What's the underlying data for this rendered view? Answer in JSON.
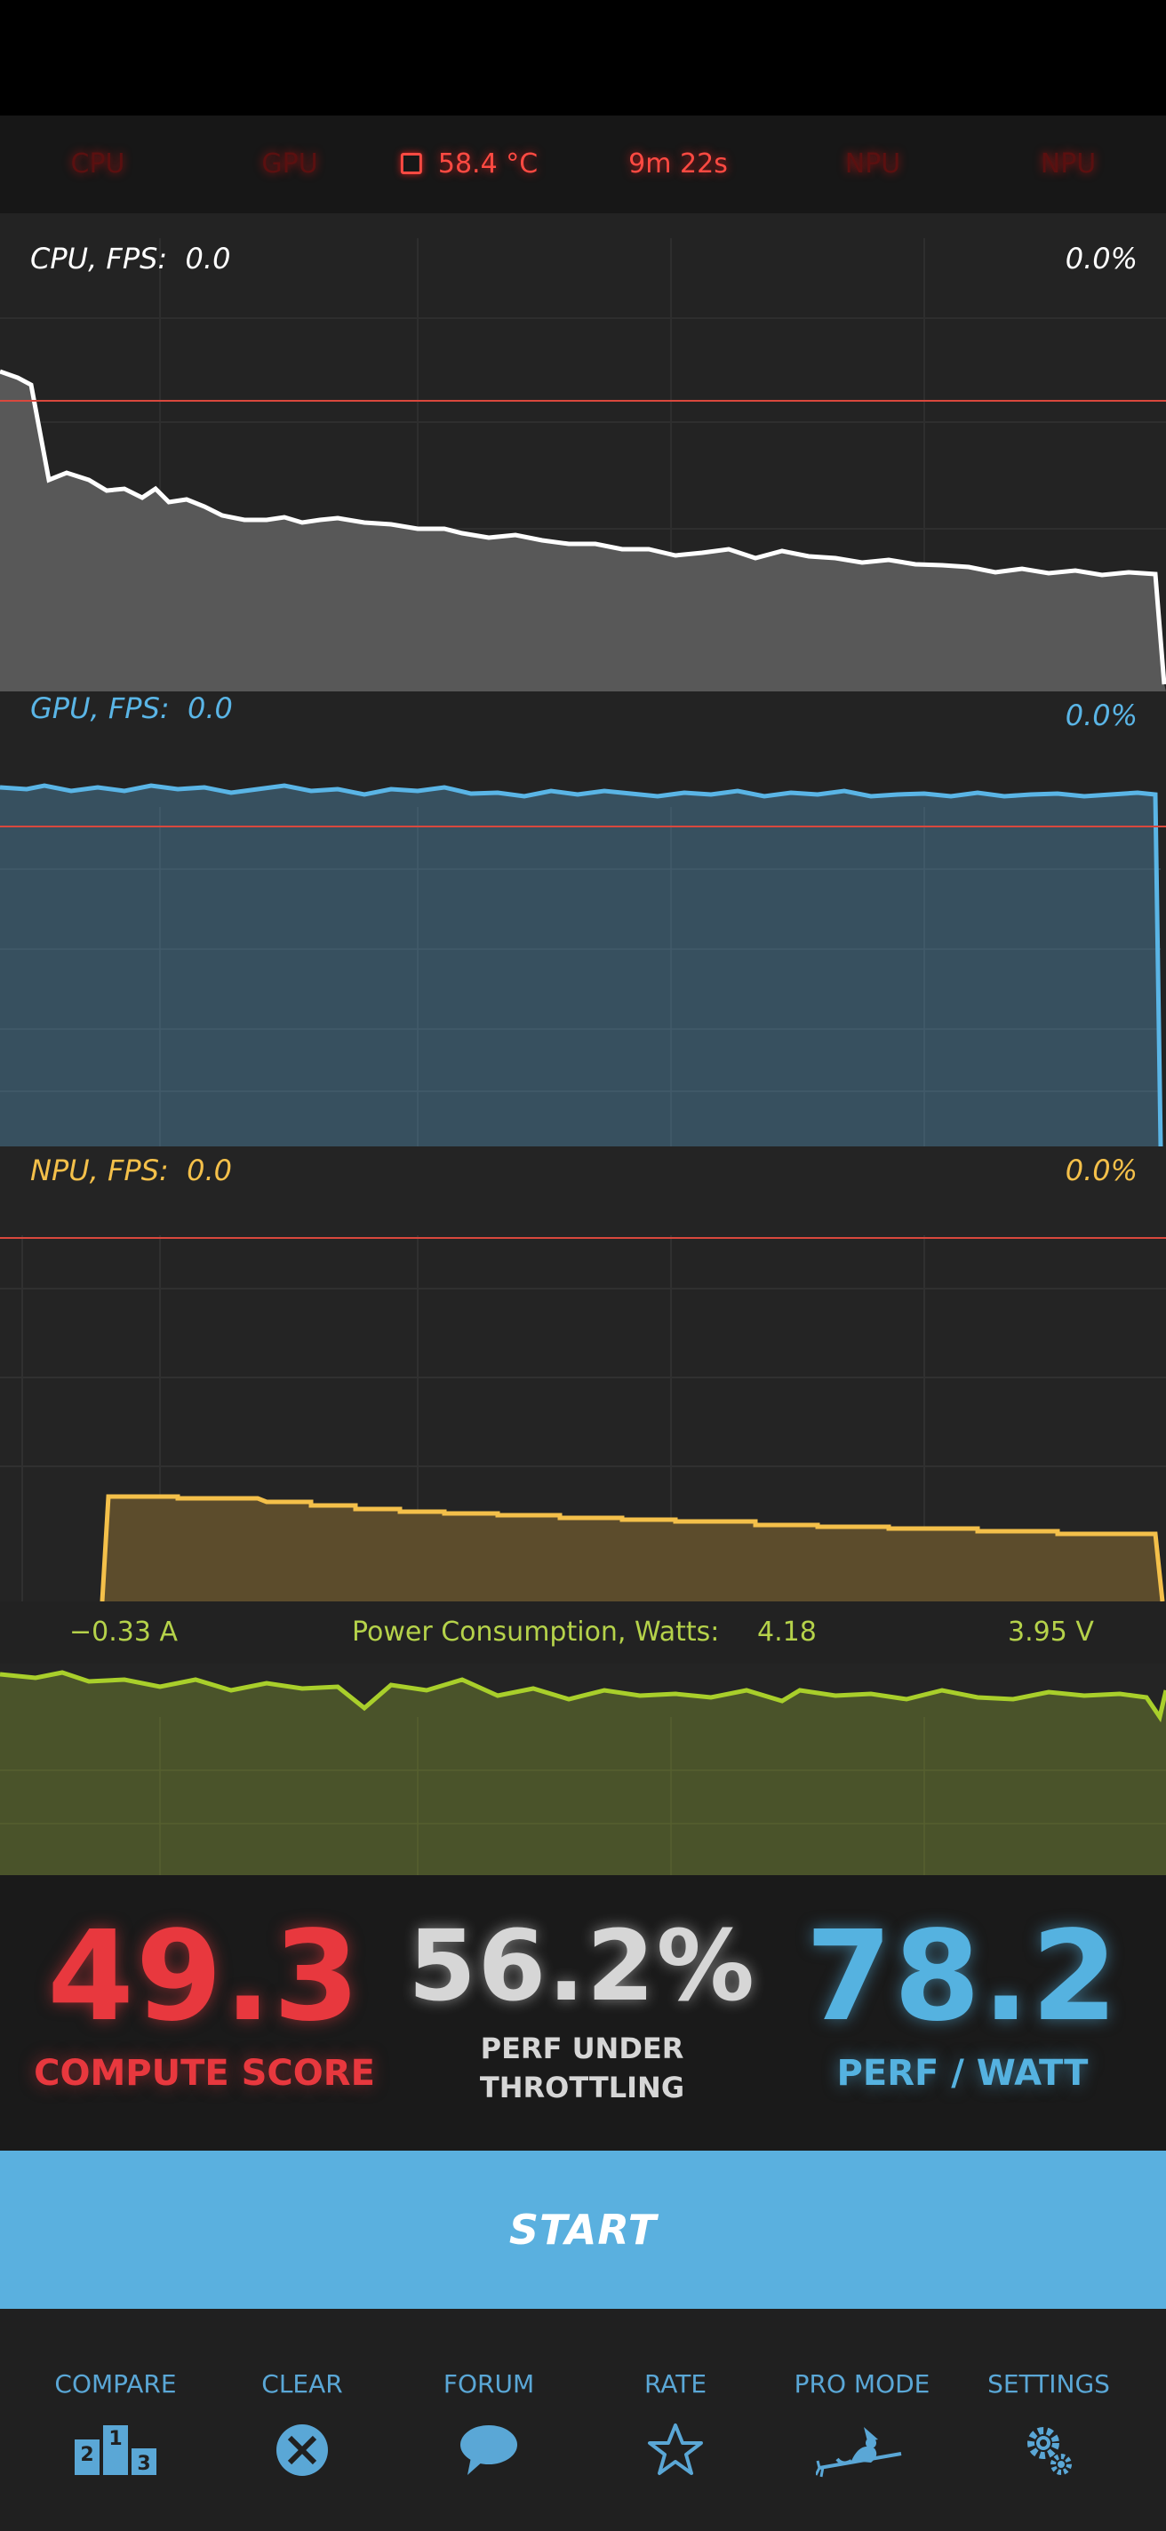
{
  "top_bar": {
    "cpu": "CPU",
    "gpu": "GPU",
    "temperature": "58.4 °C",
    "elapsed": "9m 22s",
    "npu1": "NPU",
    "npu2": "NPU"
  },
  "graphs": {
    "cpu": {
      "label": "CPU, FPS:",
      "fps": "0.0",
      "percent": "0.0%"
    },
    "gpu": {
      "label": "GPU, FPS:",
      "fps": "0.0",
      "percent": "0.0%"
    },
    "npu": {
      "label": "NPU, FPS:",
      "fps": "0.0",
      "percent": "0.0%"
    }
  },
  "power": {
    "current": "−0.33 A",
    "label": "Power Consumption, Watts:",
    "watts": "4.18",
    "voltage": "3.95 V"
  },
  "scores": {
    "compute_value": "49.3",
    "compute_label": "COMPUTE SCORE",
    "throttle_value": "56.2%",
    "throttle_label_line1": "PERF UNDER",
    "throttle_label_line2": "THROTTLING",
    "perf_watt_value": "78.2",
    "perf_watt_label": "PERF / WATT"
  },
  "start_label": "START",
  "nav": {
    "compare": "COMPARE",
    "clear": "CLEAR",
    "forum": "FORUM",
    "rate": "RATE",
    "pro_mode": "PRO MODE",
    "settings": "SETTINGS"
  },
  "colors": {
    "cpu_line": "#ffffff",
    "gpu_line": "#5ab5e6",
    "npu_line": "#f4c04a",
    "power_line": "#a9cf2b",
    "accent_red": "#e8383e",
    "accent_blue": "#55b2e0"
  },
  "icons": [
    "chip-icon",
    "podium-icon",
    "clear-x-icon",
    "speech-bubble-icon",
    "star-icon",
    "witch-icon",
    "gear-icon"
  ]
}
